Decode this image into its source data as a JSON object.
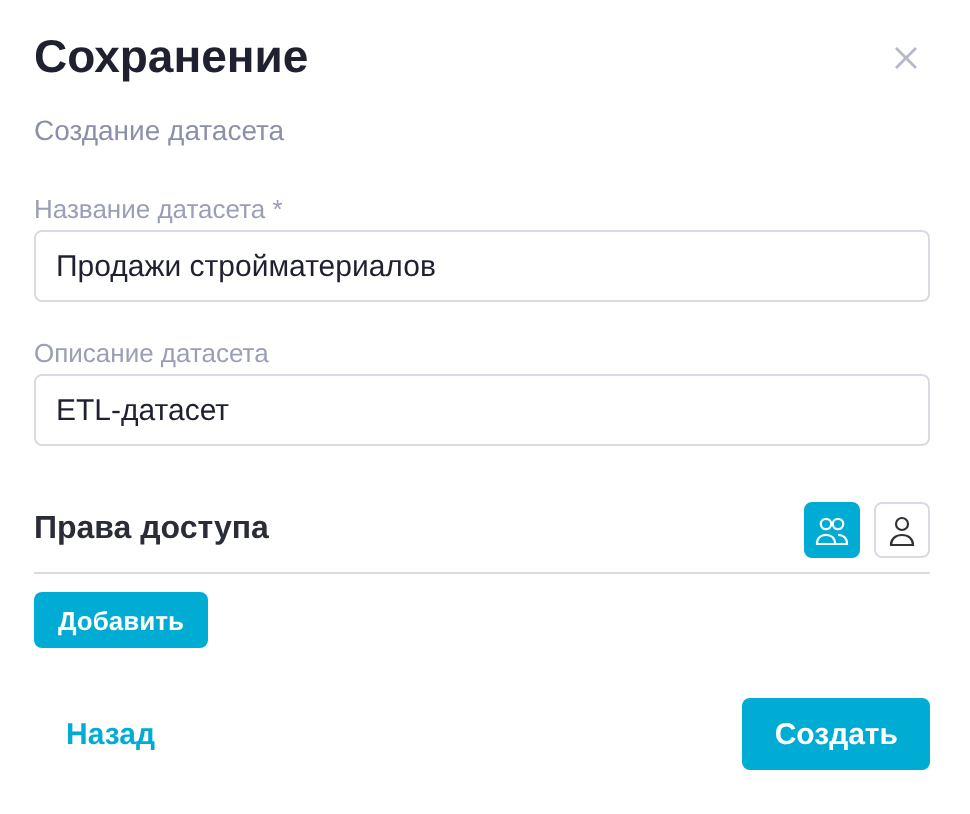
{
  "dialog": {
    "title": "Сохранение",
    "subtitle": "Создание датасета"
  },
  "fields": [
    {
      "label": "Название датасета *",
      "value": "Продажи стройматериалов"
    },
    {
      "label": "Описание датасета",
      "value": "ETL-датасет"
    }
  ],
  "access": {
    "title": "Права доступа",
    "toggles": [
      {
        "kind": "group",
        "selected": true
      },
      {
        "kind": "user",
        "selected": false
      }
    ],
    "add_button": "Добавить"
  },
  "footer": {
    "back": "Назад",
    "submit": "Создать"
  }
}
